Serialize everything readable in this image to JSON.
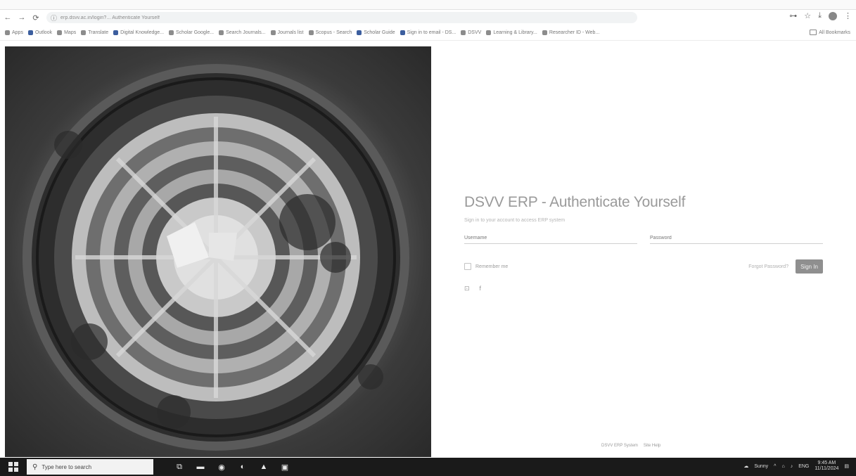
{
  "browser": {
    "url": "erp.dsvv.ac.in/login?... Authenticate Yourself",
    "nav": {
      "back": "←",
      "forward": "→",
      "reload": "⟳"
    },
    "bookmarks": [
      {
        "label": "Apps",
        "color": "gray"
      },
      {
        "label": "Outlook",
        "color": "blue"
      },
      {
        "label": "Maps",
        "color": "gray"
      },
      {
        "label": "Translate",
        "color": "gray"
      },
      {
        "label": "Digital Knowledge...",
        "color": "blue"
      },
      {
        "label": "Scholar Google...",
        "color": "gray"
      },
      {
        "label": "Search Journals...",
        "color": "gray"
      },
      {
        "label": "Journals list",
        "color": "gray"
      },
      {
        "label": "Scopus - Search",
        "color": "gray"
      },
      {
        "label": "Scholar Guide",
        "color": "blue"
      },
      {
        "label": "Sign in to email - DS...",
        "color": "blue"
      },
      {
        "label": "DSVV",
        "color": "gray"
      },
      {
        "label": "Learning & Library...",
        "color": "gray"
      },
      {
        "label": "Researcher ID - Web...",
        "color": "gray"
      }
    ],
    "all_bookmarks": "All Bookmarks"
  },
  "login": {
    "title": "DSVV ERP - Authenticate Yourself",
    "subtitle": "Sign in to your account to access ERP system",
    "username_placeholder": "Username",
    "password_placeholder": "Password",
    "remember_label": "Remember me",
    "forgot_label": "Forgot Password?",
    "signin_label": "Sign In",
    "social_icons": [
      "⊡",
      "f"
    ]
  },
  "footer": {
    "text": "DSVV ERP System",
    "link": "Site Help"
  },
  "taskbar": {
    "search_placeholder": "Type here to search",
    "weather": "Sunny",
    "lang": "ENG",
    "time": "9:45 AM",
    "date": "11/11/2024"
  }
}
